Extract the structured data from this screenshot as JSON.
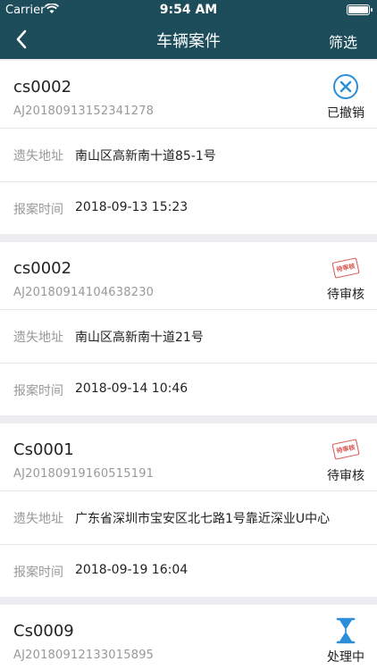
{
  "status_bar": {
    "carrier": "Carrier",
    "time": "9:54 AM"
  },
  "nav": {
    "title": "车辆案件",
    "filter": "筛选"
  },
  "labels": {
    "address": "遗失地址",
    "time": "报案时间"
  },
  "cases": [
    {
      "name": "cs0002",
      "number": "AJ20180913152341278",
      "status": "已撤销",
      "status_icon": "cancel-circle-icon",
      "address": "南山区高新南十道85-1号",
      "time": "2018-09-13 15:23"
    },
    {
      "name": "cs0002",
      "number": "AJ20180914104638230",
      "status": "待审核",
      "status_icon": "pending-stamp-icon",
      "stamp_text": "待审核",
      "address": "南山区高新南十道21号",
      "time": "2018-09-14 10:46"
    },
    {
      "name": "Cs0001",
      "number": "AJ20180919160515191",
      "status": "待审核",
      "status_icon": "pending-stamp-icon",
      "stamp_text": "待审核",
      "address": "广东省深圳市宝安区北七路1号靠近深业U中心",
      "time": "2018-09-19 16:04"
    },
    {
      "name": "Cs0009",
      "number": "AJ20180912133015895",
      "status": "处理中",
      "status_icon": "hourglass-icon"
    }
  ],
  "colors": {
    "header": "#1d4d5a",
    "accent": "#2a8fd8",
    "stamp": "#d9534f"
  }
}
